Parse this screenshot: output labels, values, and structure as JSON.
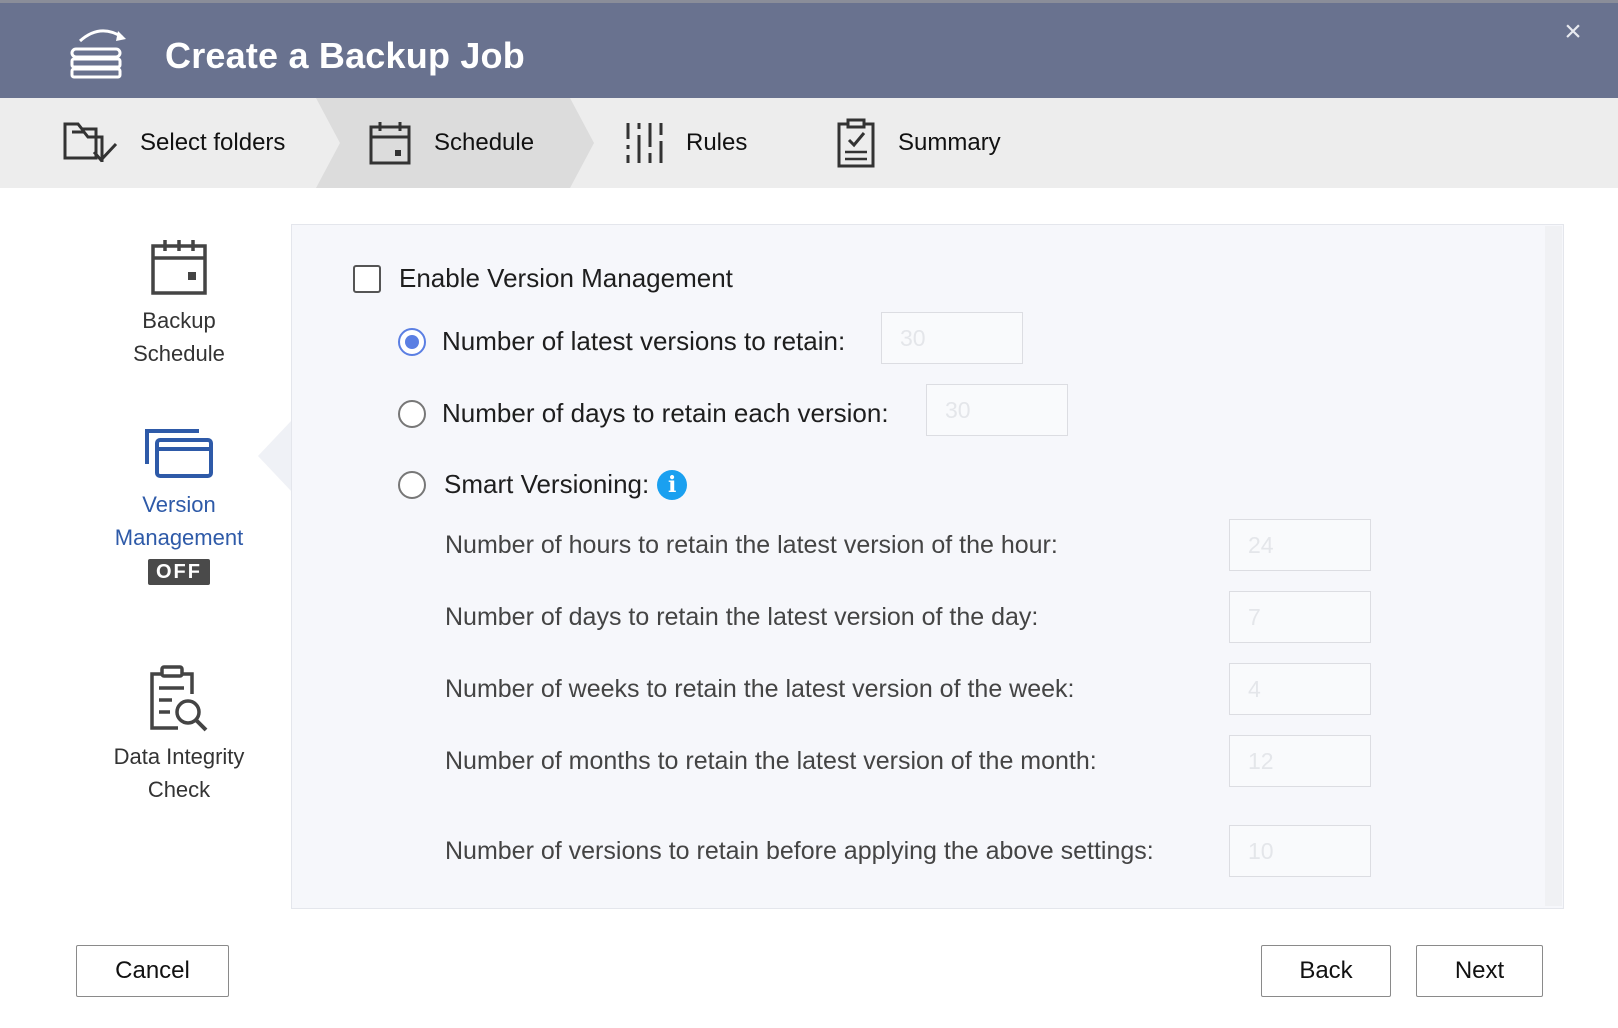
{
  "header": {
    "title": "Create a Backup Job",
    "logo_icon": "backup-sync-icon",
    "close_label": "×"
  },
  "steps": [
    {
      "label": "Select folders",
      "icon": "folder-check-icon"
    },
    {
      "label": "Schedule",
      "icon": "calendar-icon",
      "active": true
    },
    {
      "label": "Rules",
      "icon": "sliders-icon"
    },
    {
      "label": "Summary",
      "icon": "clipboard-check-icon"
    }
  ],
  "sidebar": {
    "items": [
      {
        "line1": "Backup",
        "line2": "Schedule",
        "icon": "calendar-icon"
      },
      {
        "line1": "Version",
        "line2": "Management",
        "badge": "OFF",
        "icon": "windows-stack-icon",
        "active": true
      },
      {
        "line1": "Data Integrity",
        "line2": "Check",
        "icon": "clipboard-search-icon"
      }
    ]
  },
  "version": {
    "enable_label": "Enable Version Management",
    "enable_checked": false,
    "latest_label": "Number of latest versions to retain:",
    "latest_value": "30",
    "days_label": "Number of days to retain each version:",
    "days_value": "30",
    "smart_label": "Smart Versioning:",
    "info_glyph": "i",
    "smart": {
      "hours_label": "Number of hours to retain the latest version of the hour:",
      "hours_value": "24",
      "day_label": "Number of days to retain the latest version of the day:",
      "day_value": "7",
      "week_label": "Number of weeks to retain the latest version of the week:",
      "week_value": "4",
      "month_label": "Number of months to retain the latest version of the month:",
      "month_value": "12",
      "before_label": "Number of versions to retain before applying the above settings:",
      "before_value": "10"
    }
  },
  "footer": {
    "cancel_label": "Cancel",
    "back_label": "Back",
    "next_label": "Next"
  },
  "colors": {
    "header_bg": "#69728f",
    "accent": "#5b7fe3",
    "active_text": "#2e5aa8",
    "info_blue": "#1aa0f0"
  }
}
